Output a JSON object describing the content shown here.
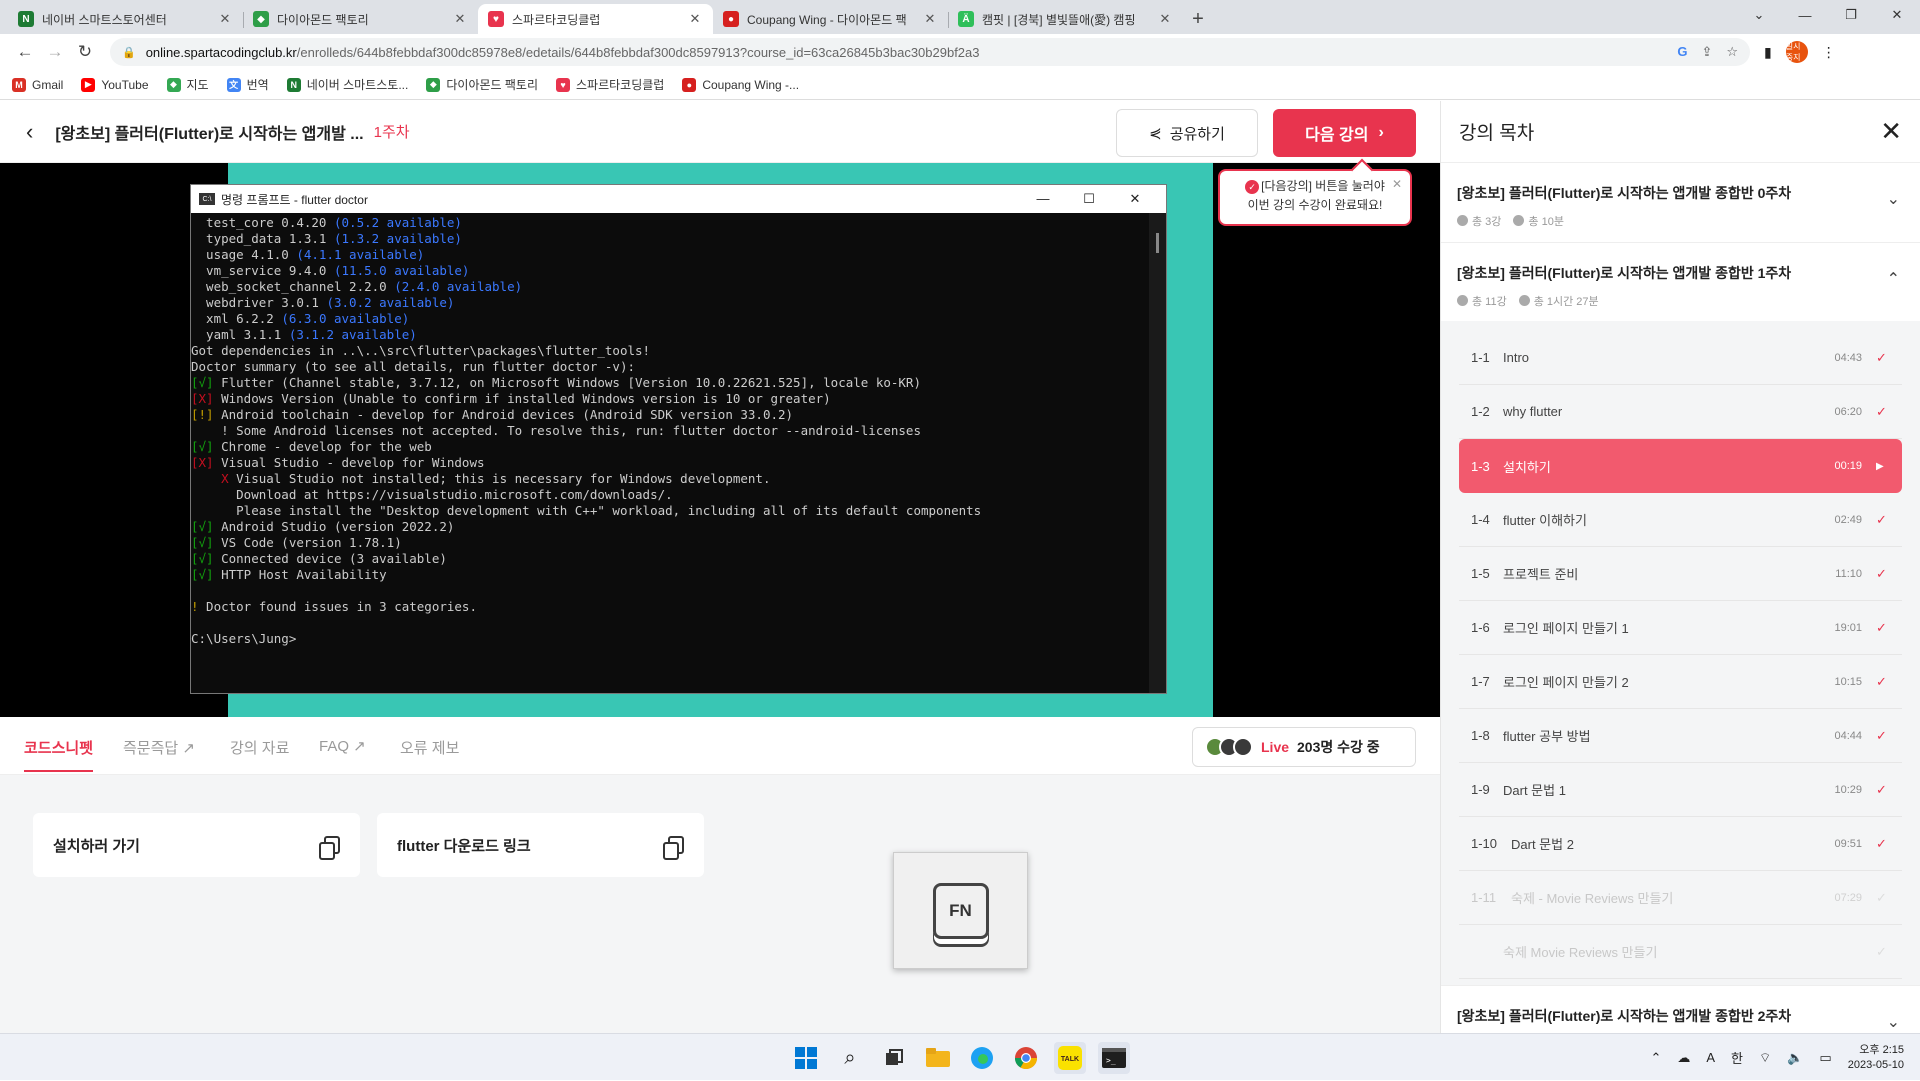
{
  "browser": {
    "tabs": [
      {
        "title": "네이버 스마트스토어센터",
        "fav_color": "#1e7b34",
        "fav_glyph": "N"
      },
      {
        "title": "다이아몬드 팩토리",
        "fav_color": "#2e9e48",
        "fav_glyph": "◆"
      },
      {
        "title": "스파르타코딩클럽",
        "fav_color": "#e8344e",
        "fav_glyph": "♥",
        "active": true
      },
      {
        "title": "Coupang Wing - 다이아몬드 팩",
        "fav_color": "#d6201f",
        "fav_glyph": "●"
      },
      {
        "title": "캠핏 | [경북] 별빛뜰애(愛) 캠핑",
        "fav_color": "#2fbf5a",
        "fav_glyph": "Ä"
      }
    ],
    "url_host": "online.spartacodingclub.kr",
    "url_path": "/enrolleds/644b8febbdaf300dc85978e8/edetails/644b8febbdaf300dc8597913?course_id=63ca26845b3bac30b29bf2a3",
    "profile_label": "일시중지",
    "bookmarks": [
      {
        "label": "Gmail",
        "color": "#d93025",
        "glyph": "M"
      },
      {
        "label": "YouTube",
        "color": "#ff0000",
        "glyph": "▶"
      },
      {
        "label": "지도",
        "color": "#34a853",
        "glyph": "◆"
      },
      {
        "label": "번역",
        "color": "#4285f4",
        "glyph": "文"
      },
      {
        "label": "네이버 스마트스토...",
        "color": "#1e7b34",
        "glyph": "N"
      },
      {
        "label": "다이아몬드 팩토리",
        "color": "#2e9e48",
        "glyph": "◆"
      },
      {
        "label": "스파르타코딩클럽",
        "color": "#e8344e",
        "glyph": "♥"
      },
      {
        "label": "Coupang Wing -...",
        "color": "#d6201f",
        "glyph": "●"
      }
    ]
  },
  "page": {
    "course_title": "[왕초보] 플러터(Flutter)로 시작하는 앱개발 ...",
    "week_label": "1주차",
    "share_label": "공유하기",
    "next_label": "다음 강의",
    "tooltip_line1": "[다음강의] 버튼을 눌러야",
    "tooltip_line2": "이번 강의 수강이 완료돼요!"
  },
  "terminal": {
    "title": "명령 프롬프트 - flutter  doctor",
    "lines": [
      [
        {
          "t": "  test_core 0.4.20 "
        },
        {
          "t": "(0.5.2 available)",
          "c": "b"
        }
      ],
      [
        {
          "t": "  typed_data 1.3.1 "
        },
        {
          "t": "(1.3.2 available)",
          "c": "b"
        }
      ],
      [
        {
          "t": "  usage 4.1.0 "
        },
        {
          "t": "(4.1.1 available)",
          "c": "b"
        }
      ],
      [
        {
          "t": "  vm_service 9.4.0 "
        },
        {
          "t": "(11.5.0 available)",
          "c": "b"
        }
      ],
      [
        {
          "t": "  web_socket_channel 2.2.0 "
        },
        {
          "t": "(2.4.0 available)",
          "c": "b"
        }
      ],
      [
        {
          "t": "  webdriver 3.0.1 "
        },
        {
          "t": "(3.0.2 available)",
          "c": "b"
        }
      ],
      [
        {
          "t": "  xml 6.2.2 "
        },
        {
          "t": "(6.3.0 available)",
          "c": "b"
        }
      ],
      [
        {
          "t": "  yaml 3.1.1 "
        },
        {
          "t": "(3.1.2 available)",
          "c": "b"
        }
      ],
      [
        {
          "t": "Got dependencies in ..\\..\\src\\flutter\\packages\\flutter_tools!"
        }
      ],
      [
        {
          "t": "Doctor summary (to see all details, run flutter doctor -v):"
        }
      ],
      [
        {
          "t": "[√]",
          "c": "g"
        },
        {
          "t": " Flutter (Channel stable, 3.7.12, on Microsoft Windows [Version 10.0.22621.525], locale ko-KR)"
        }
      ],
      [
        {
          "t": "[X]",
          "c": "r"
        },
        {
          "t": " Windows Version (Unable to confirm if installed Windows version is 10 or greater)"
        }
      ],
      [
        {
          "t": "[!]",
          "c": "y"
        },
        {
          "t": " Android toolchain - develop for Android devices (Android SDK version 33.0.2)"
        }
      ],
      [
        {
          "t": "    ! Some Android licenses not accepted. To resolve this, run: flutter doctor --android-licenses"
        }
      ],
      [
        {
          "t": "[√]",
          "c": "g"
        },
        {
          "t": " Chrome - develop for the web"
        }
      ],
      [
        {
          "t": "[X]",
          "c": "r"
        },
        {
          "t": " Visual Studio - develop for Windows"
        }
      ],
      [
        {
          "t": "    X",
          "c": "r"
        },
        {
          "t": " Visual Studio not installed; this is necessary for Windows development."
        }
      ],
      [
        {
          "t": "      Download at https://visualstudio.microsoft.com/downloads/."
        }
      ],
      [
        {
          "t": "      Please install the \"Desktop development with C++\" workload, including all of its default components"
        }
      ],
      [
        {
          "t": "[√]",
          "c": "g"
        },
        {
          "t": " Android Studio (version 2022.2)"
        }
      ],
      [
        {
          "t": "[√]",
          "c": "g"
        },
        {
          "t": " VS Code (version 1.78.1)"
        }
      ],
      [
        {
          "t": "[√]",
          "c": "g"
        },
        {
          "t": " Connected device (3 available)"
        }
      ],
      [
        {
          "t": "[√]",
          "c": "g"
        },
        {
          "t": " HTTP Host Availability"
        }
      ],
      [
        {
          "t": ""
        }
      ],
      [
        {
          "t": "!",
          "c": "y"
        },
        {
          "t": " Doctor found issues in 3 categories."
        }
      ],
      [
        {
          "t": ""
        }
      ],
      [
        {
          "t": "C:\\Users\\Jung>"
        }
      ]
    ]
  },
  "subtabs": [
    "코드스니펫",
    "즉문즉답 ↗",
    "강의 자료",
    "FAQ ↗",
    "오류 제보"
  ],
  "live": {
    "label": "Live",
    "count": "203명 수강 중"
  },
  "snippets": [
    "설치하러 가기",
    "flutter 다운로드 링크"
  ],
  "fn_key": "FN",
  "sidebar": {
    "title": "강의 목차",
    "week0": {
      "title": "[왕초보] 플러터(Flutter)로 시작하는 앱개발 종합반 0주차",
      "count": "총 3강",
      "time": "총 10분"
    },
    "week1": {
      "title": "[왕초보] 플러터(Flutter)로 시작하는 앱개발 종합반 1주차",
      "count": "총 11강",
      "time": "총 1시간 27분"
    },
    "lessons": [
      {
        "num": "1-1",
        "title": "Intro",
        "dur": "04:43",
        "state": "done"
      },
      {
        "num": "1-2",
        "title": "why flutter",
        "dur": "06:20",
        "state": "done"
      },
      {
        "num": "1-3",
        "title": "설치하기",
        "dur": "00:19",
        "state": "current"
      },
      {
        "num": "1-4",
        "title": "flutter 이해하기",
        "dur": "02:49",
        "state": "done"
      },
      {
        "num": "1-5",
        "title": "프로젝트 준비",
        "dur": "11:10",
        "state": "done"
      },
      {
        "num": "1-6",
        "title": "로그인 페이지 만들기 1",
        "dur": "19:01",
        "state": "done"
      },
      {
        "num": "1-7",
        "title": "로그인 페이지 만들기 2",
        "dur": "10:15",
        "state": "done"
      },
      {
        "num": "1-8",
        "title": "flutter 공부 방법",
        "dur": "04:44",
        "state": "done"
      },
      {
        "num": "1-9",
        "title": "Dart 문법 1",
        "dur": "10:29",
        "state": "done"
      },
      {
        "num": "1-10",
        "title": "Dart 문법 2",
        "dur": "09:51",
        "state": "done"
      },
      {
        "num": "1-11",
        "title": "숙제 - Movie Reviews 만들기",
        "dur": "07:29",
        "state": "locked"
      },
      {
        "num": "",
        "title": "숙제 Movie Reviews 만들기",
        "dur": "",
        "state": "locked"
      }
    ],
    "week2": {
      "title": "[왕초보] 플러터(Flutter)로 시작하는 앱개발 종합반 2주차"
    }
  },
  "taskbar": {
    "time": "오후 2:15",
    "date": "2023-05-10",
    "ime": "한",
    "lang": "A"
  }
}
